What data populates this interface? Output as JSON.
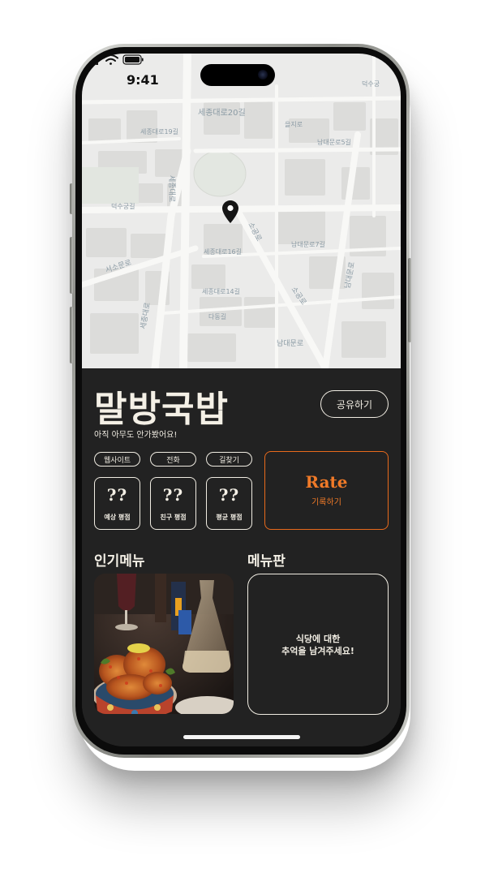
{
  "status_bar": {
    "time": "9:41"
  },
  "map": {
    "labels": {
      "sejongdaero20": "세종대로20길",
      "sejongdaero19": "세종대로19길",
      "sejongdaero_v": "세종대로",
      "deoksugungil": "덕수궁길",
      "seosomunro": "서소문로",
      "sejongdaero16": "세종대로16길",
      "sejongdaero14": "세종대로14길",
      "sejongdaero_low": "세종대로",
      "dadongil": "다동길",
      "sogongro": "소공로",
      "namdaemunro": "남대문로",
      "euljiro": "을지로",
      "namdaemunro7": "남대문로7길",
      "namdaemunro5": "남대문로5길",
      "namdaemunro_low": "남대문로",
      "sogongro2": "소공로",
      "top_right": "덕수궁"
    }
  },
  "restaurant": {
    "name": "말방국밥",
    "subtitle": "아직 아무도 안가봤어요!",
    "share_label": "공유하기"
  },
  "links": {
    "website": "웹사이트",
    "phone": "전화",
    "directions": "길찾기"
  },
  "ratings": [
    {
      "value": "??",
      "label": "예상 평점"
    },
    {
      "value": "??",
      "label": "친구 평점"
    },
    {
      "value": "??",
      "label": "평균 평점"
    }
  ],
  "rate": {
    "title": "Rate",
    "subtitle": "기록하기"
  },
  "popular_menu": {
    "title": "인기메뉴"
  },
  "menu_board": {
    "title": "메뉴판",
    "line1": "식당에 대한",
    "line2": "추억을 남겨주세요!"
  },
  "colors": {
    "accent": "#f07a28",
    "background": "#222222",
    "text": "#f0ece2"
  },
  "icons": [
    "location-pin-icon",
    "signal-icon",
    "wifi-icon",
    "battery-icon"
  ]
}
